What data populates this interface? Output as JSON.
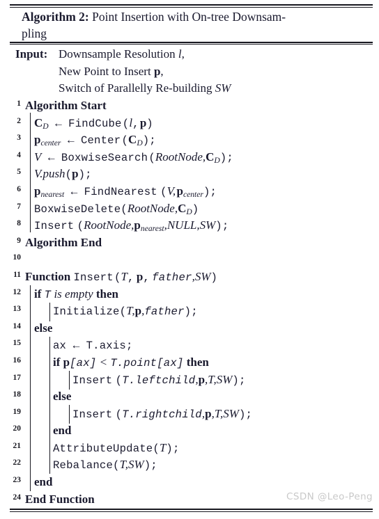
{
  "title": {
    "label": "Algorithm 2:",
    "text": "Point Insertion with On-tree Downsam-",
    "text_cont": "pling"
  },
  "input": {
    "keyword": "Input:",
    "lines": [
      "Downsample Resolution l,",
      "New Point to Insert p,",
      "Switch of Parallelly Re-building SW"
    ]
  },
  "lines": [
    {
      "num": "1",
      "text": "Algorithm Start"
    },
    {
      "num": "2",
      "text": "C_D ← FindCube (l, p)"
    },
    {
      "num": "3",
      "text": "p_center ← Center (C_D);"
    },
    {
      "num": "4",
      "text": "V ← BoxwiseSearch (RootNode, C_D);"
    },
    {
      "num": "5",
      "text": "V.push(p);"
    },
    {
      "num": "6",
      "text": "p_nearest ← FindNearest (V, p_center);"
    },
    {
      "num": "7",
      "text": "BoxwiseDelete(RootNode, C_D)"
    },
    {
      "num": "8",
      "text": "Insert (RootNode, p_nearest, NULL, SW);"
    },
    {
      "num": "9",
      "text": "Algorithm End"
    },
    {
      "num": "10",
      "text": ""
    },
    {
      "num": "11",
      "text": "Function Insert (T, p, father, SW)"
    },
    {
      "num": "12",
      "text": "if T is empty then"
    },
    {
      "num": "13",
      "text": "Initialize(T, p, father);"
    },
    {
      "num": "14",
      "text": "else"
    },
    {
      "num": "15",
      "text": "ax ← T.axis;"
    },
    {
      "num": "16",
      "text": "if p[ax] < T.point[ax] then"
    },
    {
      "num": "17",
      "text": "Insert (T.leftchild, p, T, SW);"
    },
    {
      "num": "18",
      "text": "else"
    },
    {
      "num": "19",
      "text": "Insert (T.rightchild, p, T, SW);"
    },
    {
      "num": "20",
      "text": "end"
    },
    {
      "num": "21",
      "text": "AttributeUpdate(T);"
    },
    {
      "num": "22",
      "text": "Rebalance(T, SW);"
    },
    {
      "num": "23",
      "text": "end"
    },
    {
      "num": "24",
      "text": "End Function"
    }
  ],
  "tokens": {
    "algorithm_start": "Algorithm Start",
    "algorithm_end": "Algorithm End",
    "function_kw": "Function",
    "end_function": "End Function",
    "if_kw": "if",
    "then_kw": "then",
    "else_kw": "else",
    "end_kw": "end",
    "is_empty": "is empty",
    "arrow": "←",
    "lt": "<",
    "C": "C",
    "D": "D",
    "p": "p",
    "l": "l",
    "V": "V",
    "T": "T",
    "SW": "SW",
    "NULL": "NULL",
    "RootNode": "RootNode",
    "father": "father",
    "center": "center",
    "nearest": "nearest",
    "ax": "ax",
    "fn_findcube": "FindCube",
    "fn_center": "Center",
    "fn_boxwisesearch": "BoxwiseSearch",
    "fn_push": "V.push",
    "fn_findnearest": "FindNearest",
    "fn_boxwisedelete": "BoxwiseDelete",
    "fn_insert": "Insert",
    "fn_initialize": "Initialize",
    "fn_attributeupdate": "AttributeUpdate",
    "fn_rebalance": "Rebalance",
    "t_axis": "T.axis",
    "t_point": "T.point",
    "t_leftchild": "T.leftchild",
    "t_rightchild": "T.rightchild",
    "paren_open": "(",
    "paren_close": ")",
    "bracket_open": "[",
    "bracket_close": "]",
    "comma": ",",
    "semicolon": ";",
    "dot": "."
  },
  "watermark": "CSDN @Leo-Peng",
  "colors": {
    "ink": "#1a1a2e",
    "rule": "#17171f",
    "watermark": "#c9c9c9",
    "background": "#ffffff"
  }
}
